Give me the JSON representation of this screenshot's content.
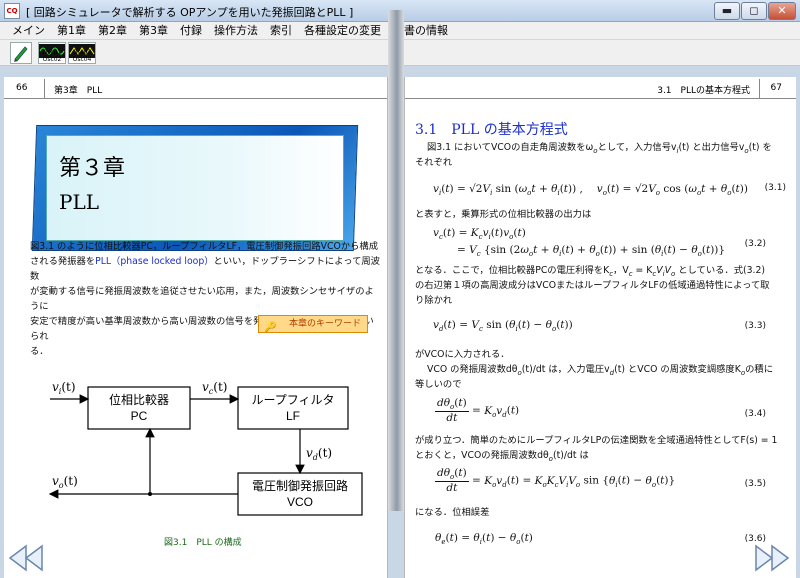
{
  "window": {
    "title": "[ 回路シミュレータで解析する OPアンプを用いた発振回路とPLL ]",
    "icon_text": "CQ",
    "minimize": "▬",
    "maximize": "◻",
    "close": "✕"
  },
  "menu": [
    "メイン",
    "第1章",
    "第2章",
    "第3章",
    "付録",
    "操作方法",
    "索引",
    "各種設定の変更",
    "本書の情報"
  ],
  "toolbar": {
    "tools": [
      {
        "name": "pen-tool",
        "label": ""
      },
      {
        "name": "scope-tool-1",
        "label": "Osc01 Osc02"
      },
      {
        "name": "scope-tool-2",
        "label": "Osc03 Osc04"
      }
    ]
  },
  "left_page": {
    "page_number": "66",
    "chapter_label": "第3章　PLL",
    "chapter_title": "第３章",
    "chapter_subtitle": "PLL",
    "para_line1": "図3.1 のように位相比較器PC，ループフィルタLF，電圧制御発振回路VCOから構成",
    "para_line2a": "される発振器を",
    "para_line2b": "PLL（phase locked loop）",
    "para_line2c": "といい，ドップラーシフトによって周波数",
    "para_line3": "が変動する信号に発振周波数を追従させたい応用，また，周波数シンセサイザのように",
    "para_line4": "安定で精度が高い基準周波数から高い周波数の信号を発振させたい用途などで用いられ",
    "para_line5": "る．",
    "keyword_button": "本章のキーワード",
    "figure_caption": "図3.1　PLL の構成",
    "diagram": {
      "pc_line1": "位相比較器",
      "pc_line2": "PC",
      "lf_line1": "ループフィルタ",
      "lf_line2": "LF",
      "vco_line1": "電圧制御発振回路",
      "vco_line2": "VCO",
      "vi": "v",
      "vi_sub": "i",
      "vc": "v",
      "vc_sub": "c",
      "vd": "v",
      "vd_sub": "d",
      "vo": "v",
      "vo_sub": "o",
      "t": "(t)"
    }
  },
  "right_page": {
    "page_number": "67",
    "chapter_label": "3.1　PLLの基本方程式",
    "section_title": "3.1　PLL の基本方程式",
    "t1a": "図3.1 においてVCOの自走角周波数をω",
    "t1b": "として，入力信号v",
    "t1c": "(t) と出力信号v",
    "t1d": "(t) を",
    "t1e": "それぞれ",
    "eq31": "v",
    "t2": "と表すと，乗算形式の位相比較器の出力は",
    "t3a": "となる．ここで，位相比較器PCの電圧利得をK",
    "t3b": "，V",
    "t3c": " = K",
    "t3d": "としている．式(3.2)",
    "t4": "の右辺第１項の高周波成分はVCOまたはループフィルタLFの低域通過特性によって取",
    "t5": "り除かれ",
    "t6": "がVCOに入力される．",
    "t7a": "VCO の発振周波数dθ",
    "t7b": "(t)/dt は，入力電圧v",
    "t7c": "(t) とVCO の周波数変調感度K",
    "t7d": "の積に",
    "t8": "等しいので",
    "t9": "が成り立つ．簡単のためにループフィルタLPの伝達関数を全域通過特性としてF(s) = 1",
    "t10a": "とおくと，VCOの発振周波数dθ",
    "t10b": "(t)/dt は",
    "t11": "になる．位相誤差",
    "eq_nums": [
      "(3.1)",
      "(3.2)",
      "(3.3)",
      "(3.4)",
      "(3.5)",
      "(3.6)"
    ]
  },
  "nav": {
    "prev": "prev-page",
    "next": "next-page"
  },
  "colors": {
    "accent": "#1a2ec8",
    "chapter_box": "#0b57b8",
    "caption": "#1a6a1a",
    "keyword": "#ffd98a"
  }
}
